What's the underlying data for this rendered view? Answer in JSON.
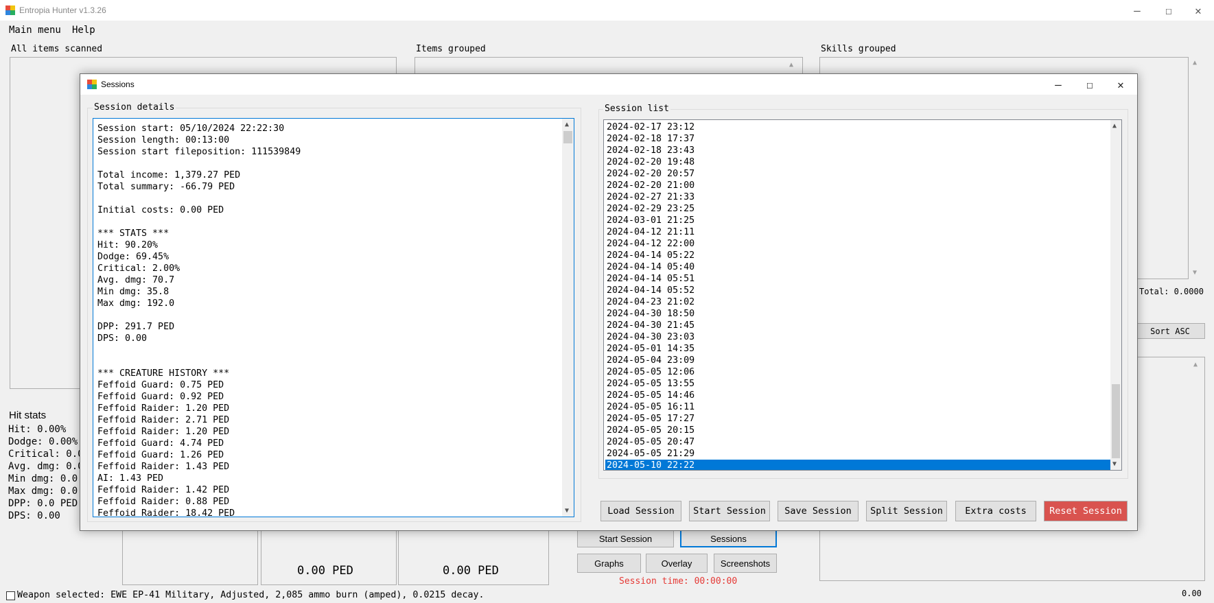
{
  "app": {
    "title": "Entropia Hunter v1.3.26",
    "menu": [
      "Main menu",
      "Help"
    ],
    "panels": {
      "all_items": "All items scanned",
      "items_grouped": "Items grouped",
      "skills_grouped": "Skills grouped"
    },
    "total_label": "Total: 0.0000",
    "sort_button": "Sort ASC",
    "bottom_right_value": "0.00",
    "hit_stats": {
      "title": "Hit stats",
      "lines": [
        "Hit: 0.00%",
        "Dodge: 0.00%",
        "Critical: 0.0",
        "Avg. dmg: 0.0",
        "Min dmg: 0.0",
        "Max dmg: 0.0",
        "",
        "DPP: 0.0 PED",
        "DPS: 0.00"
      ]
    },
    "ped_values": [
      "0.00 PED",
      "0.00 PED"
    ],
    "buttons": {
      "start_session": "Start Session",
      "sessions": "Sessions",
      "graphs": "Graphs",
      "overlay": "Overlay",
      "screenshots": "Screenshots"
    },
    "session_time": "Session time: 00:00:00",
    "weapon_selected": "Weapon selected: EWE EP-41 Military, Adjusted, 2,085 ammo burn (amped), 0.0215 decay."
  },
  "dialog": {
    "title": "Sessions",
    "details_label": "Session details",
    "details_lines": [
      "Session start: 05/10/2024 22:22:30",
      "Session length: 00:13:00",
      "Session start fileposition: 111539849",
      "",
      "Total income: 1,379.27 PED",
      "Total summary: -66.79 PED",
      "",
      "Initial costs: 0.00 PED",
      "",
      "*** STATS ***",
      "Hit: 90.20%",
      "Dodge: 69.45%",
      "Critical: 2.00%",
      "Avg. dmg: 70.7",
      "Min dmg: 35.8",
      "Max dmg: 192.0",
      "",
      "DPP: 291.7 PED",
      "DPS: 0.00",
      "",
      "",
      "*** CREATURE HISTORY ***",
      "Feffoid Guard: 0.75 PED",
      "Feffoid Guard: 0.92 PED",
      "Feffoid Raider: 1.20 PED",
      "Feffoid Raider: 2.71 PED",
      "Feffoid Raider: 1.20 PED",
      "Feffoid Guard: 4.74 PED",
      "Feffoid Guard: 1.26 PED",
      "Feffoid Raider: 1.43 PED",
      "AI: 1.43 PED",
      "Feffoid Raider: 1.42 PED",
      "Feffoid Raider: 0.88 PED",
      "Feffoid Raider: 18.42 PED"
    ],
    "list_label": "Session list",
    "sessions": [
      "2024-02-17 23:12",
      "2024-02-18 17:37",
      "2024-02-18 23:43",
      "2024-02-20 19:48",
      "2024-02-20 20:57",
      "2024-02-20 21:00",
      "2024-02-27 21:33",
      "2024-02-29 23:25",
      "2024-03-01 21:25",
      "2024-04-12 21:11",
      "2024-04-12 22:00",
      "2024-04-14 05:22",
      "2024-04-14 05:40",
      "2024-04-14 05:51",
      "2024-04-14 05:52",
      "2024-04-23 21:02",
      "2024-04-30 18:50",
      "2024-04-30 21:45",
      "2024-04-30 23:03",
      "2024-05-01 14:35",
      "2024-05-04 23:09",
      "2024-05-05 12:06",
      "2024-05-05 13:55",
      "2024-05-05 14:46",
      "2024-05-05 16:11",
      "2024-05-05 17:27",
      "2024-05-05 20:15",
      "2024-05-05 20:47",
      "2024-05-05 21:29",
      "2024-05-10 22:22"
    ],
    "selected_index": 29,
    "buttons": [
      "Load Session",
      "Start Session",
      "Save Session",
      "Split Session",
      "Extra costs",
      "Reset Session"
    ],
    "reset_color": "#d9534f"
  }
}
